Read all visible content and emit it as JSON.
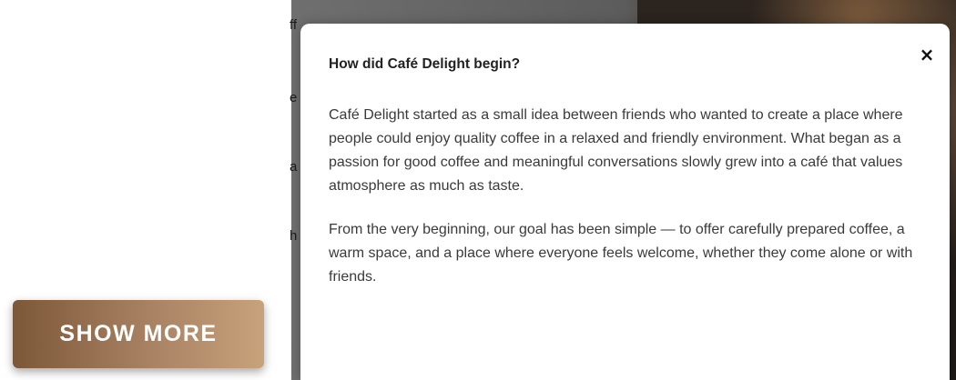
{
  "page": {
    "show_more_label": "SHOW MORE",
    "background_fragments": [
      "ff",
      "e",
      "a",
      "h"
    ]
  },
  "modal": {
    "title": "How did Café Delight begin?",
    "close_label": "×",
    "paragraphs": [
      "Café Delight started as a small idea between friends who wanted to create a place where people could enjoy quality coffee in a relaxed and friendly environment. What began as a passion for good coffee and meaningful conversations slowly grew into a café that values atmosphere as much as taste.",
      "From the very beginning, our goal has been simple — to offer carefully prepared coffee, a warm space, and a place where everyone feels welcome, whether they come alone or with friends."
    ]
  },
  "colors": {
    "button_gradient_start": "#7d5838",
    "button_gradient_end": "#c8a27a",
    "overlay": "#5c5c5c",
    "modal_background": "#ffffff",
    "title_text": "#222222",
    "body_text": "#3a3a3a"
  },
  "icons": {
    "close": "close-icon"
  }
}
